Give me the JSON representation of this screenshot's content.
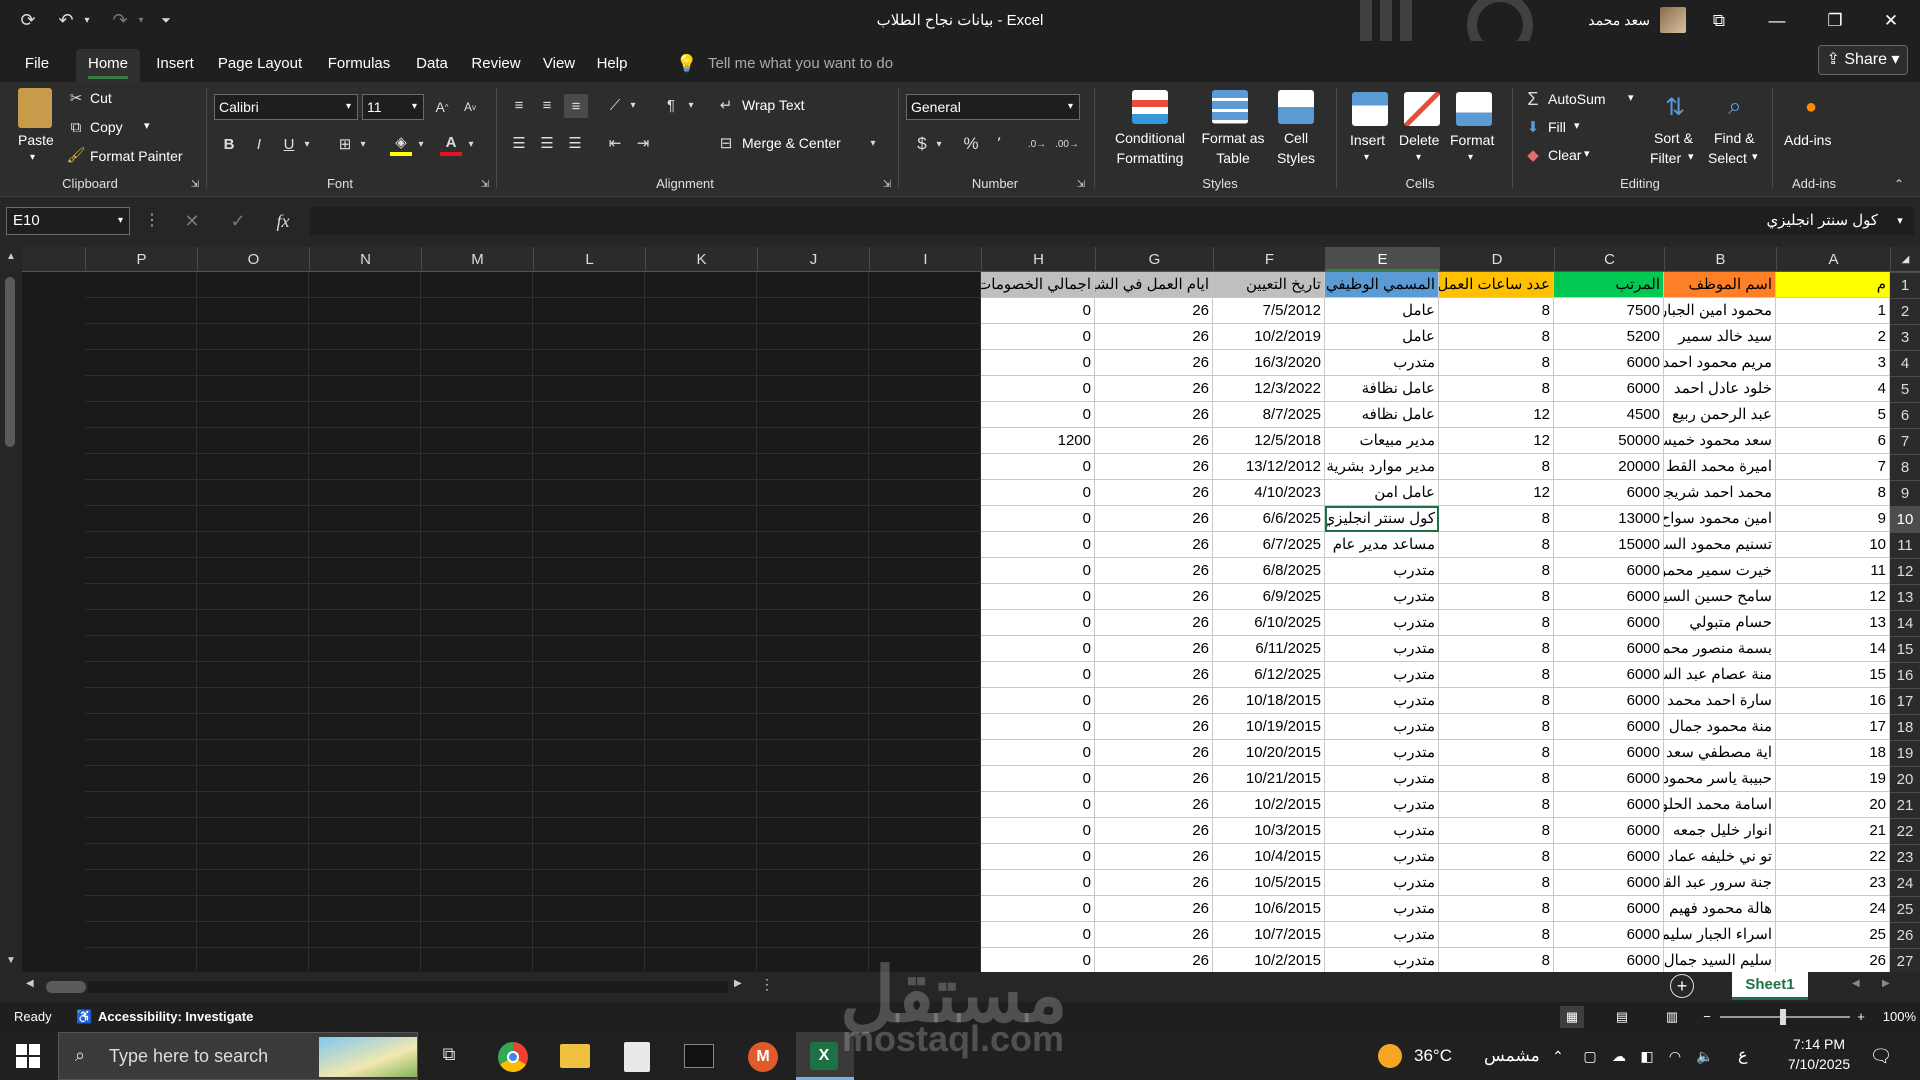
{
  "app": {
    "title": "بيانات نجاح الطلاب  -  Excel",
    "user": "سعد محمد",
    "share": "Share"
  },
  "tabs": [
    "File",
    "Home",
    "Insert",
    "Page Layout",
    "Formulas",
    "Data",
    "Review",
    "View",
    "Help"
  ],
  "tell_me": "Tell me what you want to do",
  "ribbon": {
    "clipboard": {
      "paste": "Paste",
      "cut": "Cut",
      "copy": "Copy",
      "format_painter": "Format Painter",
      "group": "Clipboard"
    },
    "font": {
      "name": "Calibri",
      "size": "11",
      "group": "Font",
      "bold": "B",
      "italic": "I",
      "underline": "U"
    },
    "alignment": {
      "wrap": "Wrap Text",
      "merge": "Merge & Center",
      "group": "Alignment"
    },
    "number": {
      "format": "General",
      "group": "Number",
      "currency": "$",
      "percent": "%",
      "comma": "٬"
    },
    "styles": {
      "cond": "Conditional",
      "cond2": "Formatting",
      "fmt_table": "Format as",
      "fmt_table2": "Table",
      "cell_styles": "Cell",
      "cell_styles2": "Styles",
      "group": "Styles"
    },
    "cells": {
      "insert": "Insert",
      "delete": "Delete",
      "format": "Format",
      "group": "Cells"
    },
    "editing": {
      "autosum": "AutoSum",
      "fill": "Fill",
      "clear": "Clear",
      "sort": "Sort &",
      "sort2": "Filter",
      "find": "Find &",
      "find2": "Select",
      "group": "Editing"
    },
    "addins": {
      "label": "Add-ins",
      "group": "Add-ins"
    }
  },
  "formula": {
    "namebox": "E10",
    "fx": "fx",
    "value": "كول سنتر انجليزي"
  },
  "columns": [
    "A",
    "B",
    "C",
    "D",
    "E",
    "F",
    "G",
    "H",
    "I",
    "J",
    "K",
    "L",
    "M",
    "N",
    "O",
    "P"
  ],
  "selected": {
    "col": "E",
    "row": "10"
  },
  "headers": [
    "م",
    "اسم الموظف",
    "المرتب",
    "عدد ساعات العمل",
    "المسمي الوظيفي",
    "تاريخ التعيين",
    "ايام العمل في الشهر",
    "اجمالي الخصومات"
  ],
  "header_colors": [
    "#ffff00",
    "#ff7f27",
    "#00c853",
    "#ffc000",
    "#5b9bd5",
    "#bfbfbf",
    "#bfbfbf",
    "#bfbfbf"
  ],
  "rows": [
    [
      "1",
      "محمود امين الجبار",
      "7500",
      "8",
      "عامل",
      "7/5/2012",
      "26",
      "0"
    ],
    [
      "2",
      "سيد خالد سمير",
      "5200",
      "8",
      "عامل",
      "10/2/2019",
      "26",
      "0"
    ],
    [
      "3",
      "مريم محمود احمد",
      "6000",
      "8",
      "متدرب",
      "16/3/2020",
      "26",
      "0"
    ],
    [
      "4",
      "خلود عادل احمد",
      "6000",
      "8",
      "عامل نظافة",
      "12/3/2022",
      "26",
      "0"
    ],
    [
      "5",
      "عبد الرحمن ربيع",
      "4500",
      "12",
      "عامل نظافه",
      "8/7/2025",
      "26",
      "0"
    ],
    [
      "6",
      "سعد محمود خميس",
      "50000",
      "12",
      "مدير مبيعات",
      "12/5/2018",
      "26",
      "1200"
    ],
    [
      "7",
      "اميرة محمد القط",
      "20000",
      "8",
      "مدير موارد بشرية",
      "13/12/2012",
      "26",
      "0"
    ],
    [
      "8",
      "محمد احمد شريجي",
      "6000",
      "12",
      "عامل امن",
      "4/10/2023",
      "26",
      "0"
    ],
    [
      "9",
      "امين محمود سواح",
      "13000",
      "8",
      "كول سنتر انجليزي",
      "6/6/2025",
      "26",
      "0"
    ],
    [
      "10",
      "تسنيم محمود السيد",
      "15000",
      "8",
      "مساعد مدير عام",
      "6/7/2025",
      "26",
      "0"
    ],
    [
      "11",
      "خيرت سمير محمود",
      "6000",
      "8",
      "متدرب",
      "6/8/2025",
      "26",
      "0"
    ],
    [
      "12",
      "سامح حسين السيد",
      "6000",
      "8",
      "متدرب",
      "6/9/2025",
      "26",
      "0"
    ],
    [
      "13",
      "حسام متبولي",
      "6000",
      "8",
      "متدرب",
      "6/10/2025",
      "26",
      "0"
    ],
    [
      "14",
      "بسمة منصور محمد",
      "6000",
      "8",
      "متدرب",
      "6/11/2025",
      "26",
      "0"
    ],
    [
      "15",
      "منة عصام عبد السلام",
      "6000",
      "8",
      "متدرب",
      "6/12/2025",
      "26",
      "0"
    ],
    [
      "16",
      "سارة احمد محمد",
      "6000",
      "8",
      "متدرب",
      "10/18/2015",
      "26",
      "0"
    ],
    [
      "17",
      "منة محمود جمال",
      "6000",
      "8",
      "متدرب",
      "10/19/2015",
      "26",
      "0"
    ],
    [
      "18",
      "اية مصطفي سعد",
      "6000",
      "8",
      "متدرب",
      "10/20/2015",
      "26",
      "0"
    ],
    [
      "19",
      "حبيبة ياسر محمود",
      "6000",
      "8",
      "متدرب",
      "10/21/2015",
      "26",
      "0"
    ],
    [
      "20",
      "اسامة محمد الحلو",
      "6000",
      "8",
      "متدرب",
      "10/2/2015",
      "26",
      "0"
    ],
    [
      "21",
      "انوار خليل جمعه",
      "6000",
      "8",
      "متدرب",
      "10/3/2015",
      "26",
      "0"
    ],
    [
      "22",
      "تو ني خليفه عماد",
      "6000",
      "8",
      "متدرب",
      "10/4/2015",
      "26",
      "0"
    ],
    [
      "23",
      "جنة سرور عبد القادر",
      "6000",
      "8",
      "متدرب",
      "10/5/2015",
      "26",
      "0"
    ],
    [
      "24",
      "هالة محمود فهيم",
      "6000",
      "8",
      "متدرب",
      "10/6/2015",
      "26",
      "0"
    ],
    [
      "25",
      "اسراء الجبار سليم",
      "6000",
      "8",
      "متدرب",
      "10/7/2015",
      "26",
      "0"
    ],
    [
      "26",
      "سليم السيد جمال",
      "6000",
      "8",
      "متدرب",
      "10/2/2015",
      "26",
      "0"
    ]
  ],
  "row_numbers": [
    "1",
    "2",
    "3",
    "4",
    "5",
    "6",
    "7",
    "8",
    "9",
    "10",
    "11",
    "12",
    "13",
    "14",
    "15",
    "16",
    "17",
    "18",
    "19",
    "20",
    "21",
    "22",
    "23",
    "24",
    "25",
    "26",
    "27"
  ],
  "sheet": {
    "name": "Sheet1"
  },
  "status": {
    "ready": "Ready",
    "accessibility": "Accessibility: Investigate",
    "zoom": "100%"
  },
  "taskbar": {
    "search": "Type here to search",
    "temp": "36°C",
    "weather": "مشمس",
    "lang": "ع",
    "time": "7:14 PM",
    "date": "7/10/2025"
  },
  "watermark": {
    "arabic": "مستقل",
    "latin": "mostaql.com"
  }
}
